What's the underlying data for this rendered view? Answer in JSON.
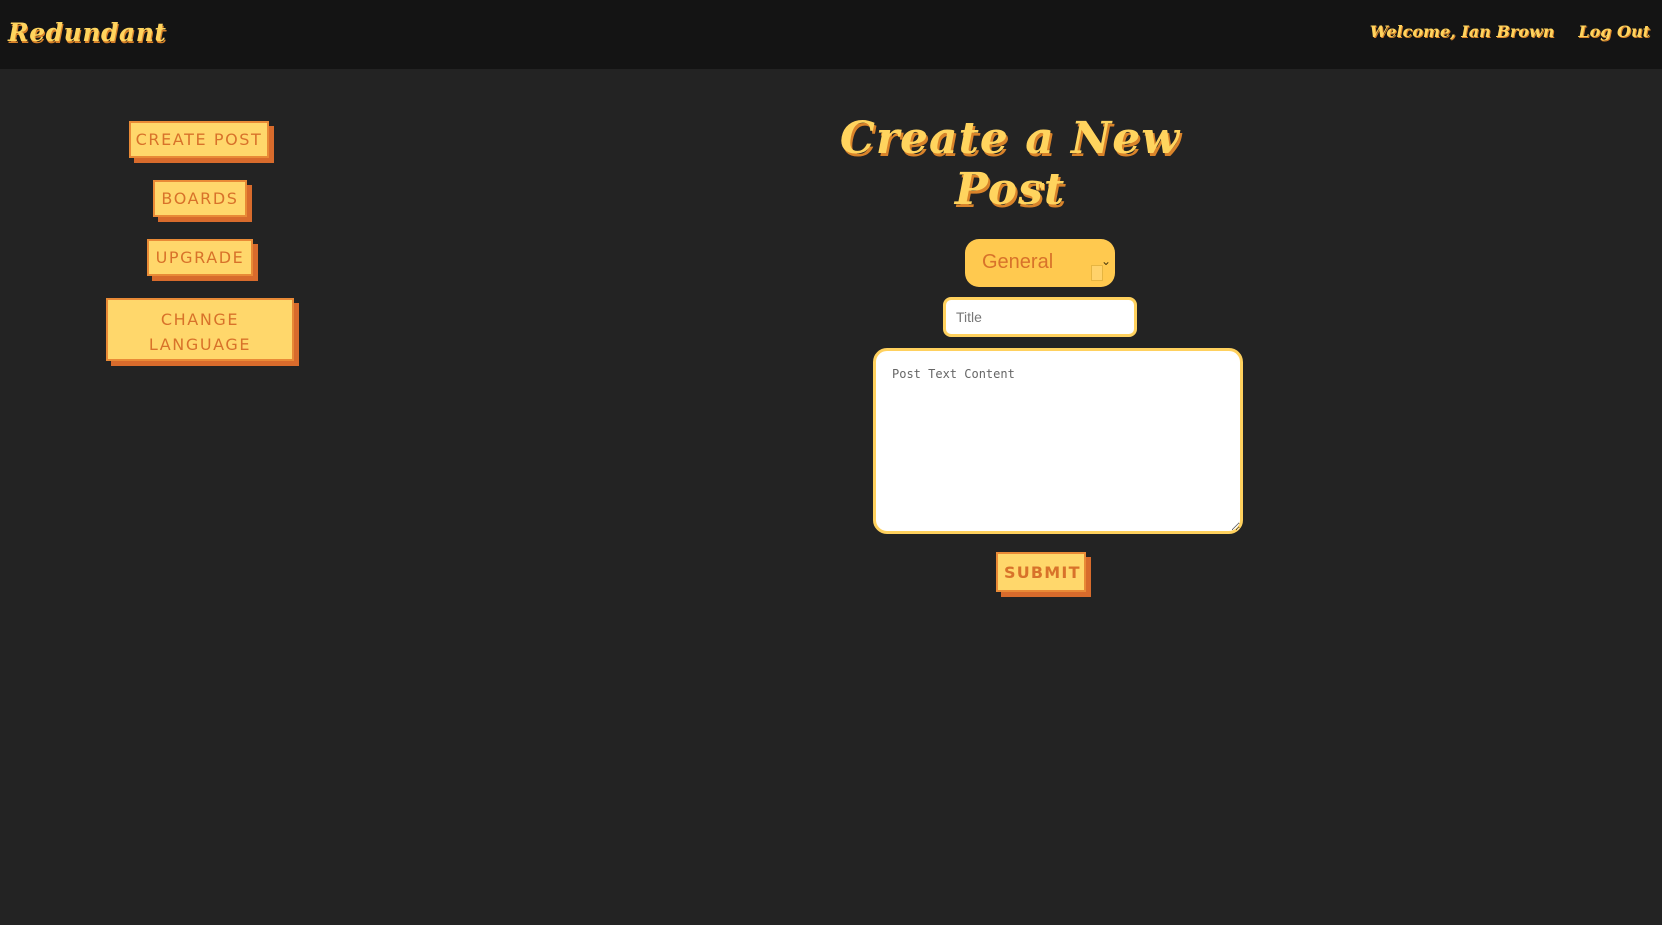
{
  "header": {
    "brand": "Redundant",
    "welcome": "Welcome, Ian Brown",
    "logout": "Log Out"
  },
  "sidebar": {
    "items": [
      {
        "label": "CREATE POST"
      },
      {
        "label": "BOARDS"
      },
      {
        "label": "UPGRADE"
      },
      {
        "label_line1": "CHANGE",
        "label_line2": "LANGUAGE"
      }
    ]
  },
  "main": {
    "title": "Create a New Post",
    "subtitle": "\"",
    "board_select": {
      "selected": "General"
    },
    "title_field": {
      "placeholder": "Title"
    },
    "content_field": {
      "placeholder": "Post Text Content"
    },
    "submit_label": "SUBMIT"
  },
  "colors": {
    "background": "#232323",
    "topbar": "#141414",
    "accent_yellow": "#ffd45e",
    "accent_orange": "#d8722a"
  },
  "icons": {
    "select_chevron": "chevron-down-icon"
  }
}
